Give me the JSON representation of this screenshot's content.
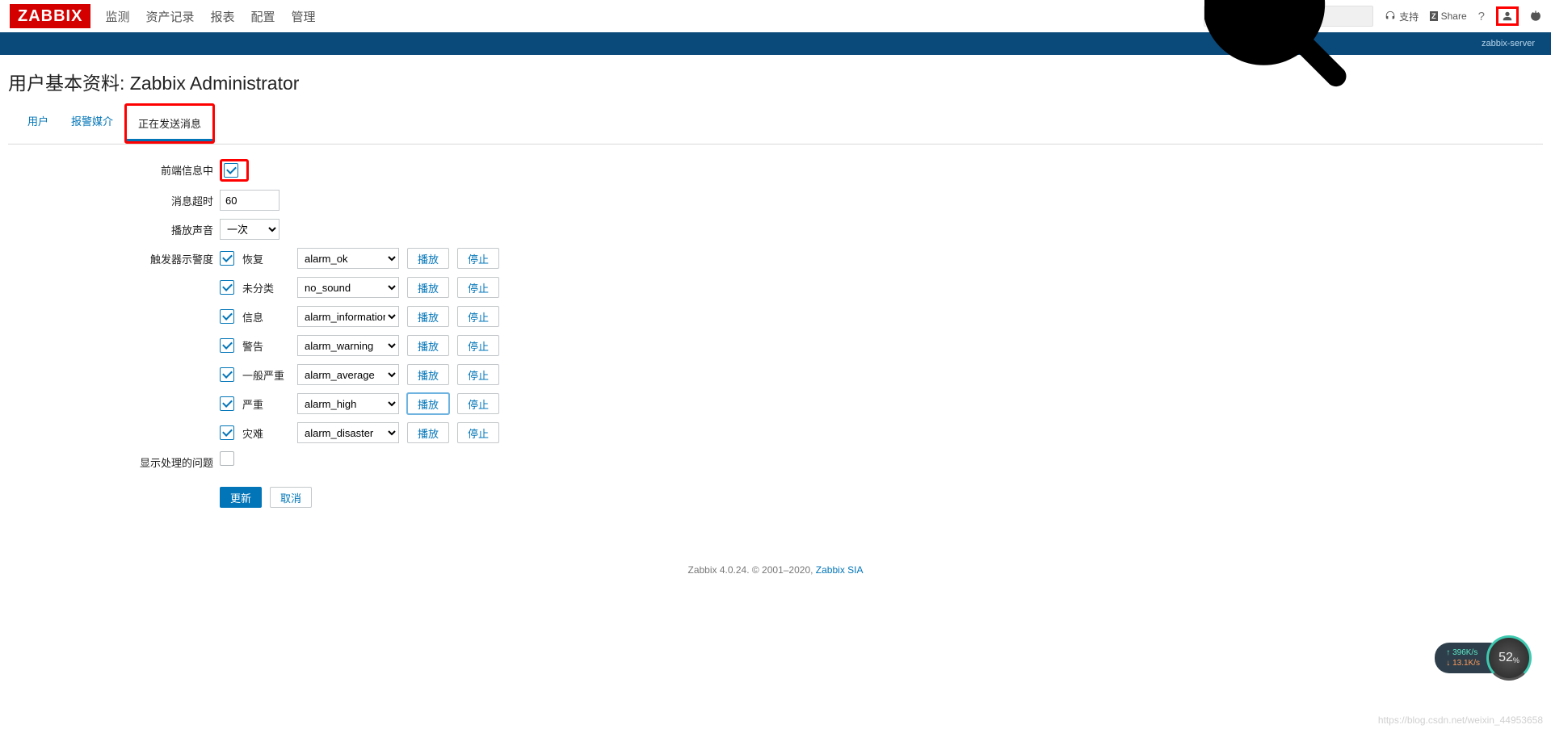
{
  "brand": "ZABBIX",
  "nav": {
    "items": [
      "监测",
      "资产记录",
      "报表",
      "配置",
      "管理"
    ]
  },
  "toplinks": {
    "support": "支持",
    "share": "Share"
  },
  "bluestrip": "zabbix-server",
  "page_title": "用户基本资料: Zabbix Administrator",
  "tabs": {
    "user": "用户",
    "media": "报警媒介",
    "messaging": "正在发送消息"
  },
  "form": {
    "frontend_label": "前端信息中",
    "timeout_label": "消息超时",
    "timeout_value": "60",
    "sound_label": "播放声音",
    "sound_value": "一次",
    "severity_label": "触发器示警度",
    "show_suppressed_label": "显示处理的问题",
    "play_btn": "播放",
    "stop_btn": "停止",
    "severities": [
      {
        "label": "恢复",
        "sound": "alarm_ok"
      },
      {
        "label": "未分类",
        "sound": "no_sound"
      },
      {
        "label": "信息",
        "sound": "alarm_information"
      },
      {
        "label": "警告",
        "sound": "alarm_warning"
      },
      {
        "label": "一般严重",
        "sound": "alarm_average"
      },
      {
        "label": "严重",
        "sound": "alarm_high"
      },
      {
        "label": "灾难",
        "sound": "alarm_disaster"
      }
    ]
  },
  "actions": {
    "update": "更新",
    "cancel": "取消"
  },
  "footer": {
    "text": "Zabbix 4.0.24. © 2001–2020, ",
    "link": "Zabbix SIA"
  },
  "watermark": "https://blog.csdn.net/weixin_44953658",
  "widget": {
    "up": "396K/s",
    "down": "13.1K/s",
    "pct": "52",
    "pct_sfx": "%"
  }
}
